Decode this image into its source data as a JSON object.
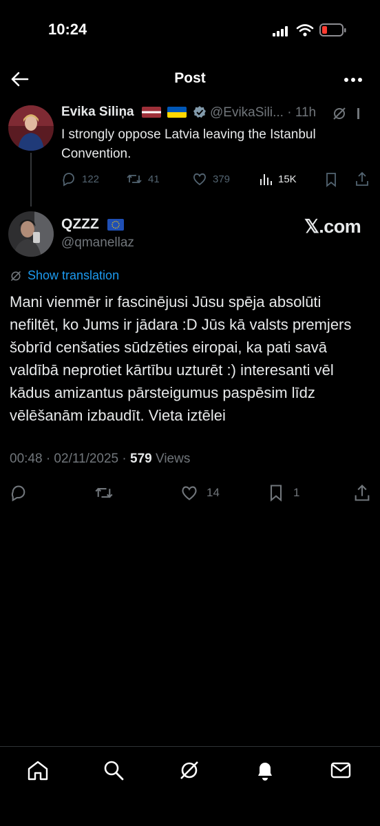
{
  "status_bar": {
    "time": "10:24"
  },
  "header": {
    "title": "Post"
  },
  "parent_tweet": {
    "author_name": "Evika Siliņa",
    "flags": "🇱🇻 🇺🇦",
    "handle": "@EvikaSili...",
    "separator": "·",
    "time": "11h",
    "text": "I strongly oppose Latvia leaving the Istanbul Convention.",
    "stats": {
      "replies": "122",
      "reposts": "41",
      "likes": "379",
      "views": "15K"
    }
  },
  "main_tweet": {
    "author_name": "QZZZ",
    "handle": "@qmanellaz",
    "watermark": "𝕏.com",
    "show_translation": "Show translation",
    "text": "Mani vienmēr ir fascinējusi Jūsu spēja absolūti nefiltēt, ko Jums ir jādara :D Jūs kā valsts premjers šobrīd cenšaties sūdzēties eiropai, ka pati savā valdībā neprotiet kārtību uzturēt :) interesanti vēl kādus amizantus pārsteigumus paspēsim līdz vēlēšanām izbaudīt. Vieta iztēlei",
    "date_time": "00:48 · 02/11/2025 ·",
    "views_count": "579",
    "views_label": "Views",
    "likes": "14",
    "bookmarks": "1"
  },
  "colors": {
    "accent": "#1d9bf0",
    "background": "#000000",
    "muted": "#71767b"
  },
  "nav": {
    "items": [
      "home-icon",
      "search-icon",
      "grok-icon",
      "notifications-icon",
      "messages-icon"
    ]
  }
}
